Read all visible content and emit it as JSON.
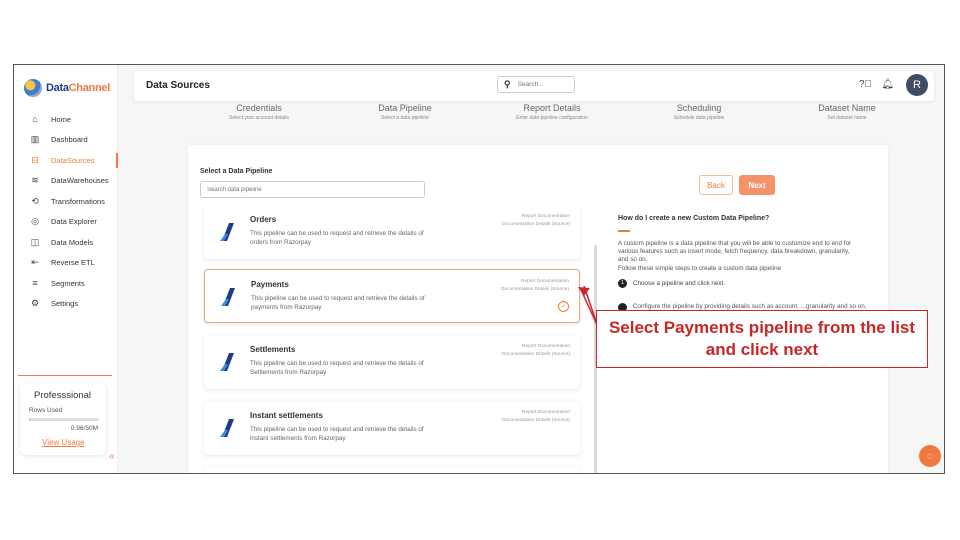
{
  "app": {
    "brand_prefix": "Data",
    "brand_suffix": "Channel"
  },
  "sidebar": {
    "items": [
      {
        "label": "Home",
        "icon": "home-icon",
        "glyph": "⌂"
      },
      {
        "label": "Dashboard",
        "icon": "dashboard-icon",
        "glyph": "▥"
      },
      {
        "label": "DataSources",
        "icon": "datasources-icon",
        "glyph": "⊟",
        "active": true
      },
      {
        "label": "DataWarehouses",
        "icon": "database-icon",
        "glyph": "≋"
      },
      {
        "label": "Transformations",
        "icon": "transform-icon",
        "glyph": "⟲"
      },
      {
        "label": "Data Explorer",
        "icon": "explorer-icon",
        "glyph": "◎"
      },
      {
        "label": "Data Models",
        "icon": "models-icon",
        "glyph": "◫"
      },
      {
        "label": "Reverse ETL",
        "icon": "reverse-etl-icon",
        "glyph": "⇤"
      },
      {
        "label": "Segments",
        "icon": "segments-icon",
        "glyph": "≡"
      },
      {
        "label": "Settings",
        "icon": "settings-icon",
        "glyph": "⚙"
      }
    ],
    "plan": {
      "title": "Professsional",
      "rows_label": "Rows Used",
      "rows_used_fraction": 0.02,
      "rows_count": "0.96/50M",
      "view_usage": "View Usage",
      "collapse_glyph": "«"
    }
  },
  "header": {
    "title": "Data Sources",
    "search_placeholder": "Search...",
    "avatar_letter": "R"
  },
  "steps": [
    {
      "title": "Credentials",
      "subtitle": "Select your account details"
    },
    {
      "title": "Data Pipeline",
      "subtitle": "Select a data pipeline"
    },
    {
      "title": "Report Details",
      "subtitle": "Enter data pipeline configuration"
    },
    {
      "title": "Scheduling",
      "subtitle": "Schedule data pipeline"
    },
    {
      "title": "Dataset Name",
      "subtitle": "Set dataset name"
    }
  ],
  "main": {
    "select_label": "Select a Data Pipeline",
    "pipeline_search_placeholder": "Search data pipeline",
    "back_label": "Back",
    "next_label": "Next",
    "doc_line1": "Report Documentation",
    "doc_line2": "Documentation Details (Source)",
    "pipelines": [
      {
        "name": "Orders",
        "description": "This pipeline can be used to request and retrieve the details of orders from Razorpay",
        "selected": false
      },
      {
        "name": "Payments",
        "description": "This pipeline can be used to request and retrieve the details of payments from Razorpay",
        "selected": true
      },
      {
        "name": "Settlements",
        "description": "This pipeline can be used to request and retrieve the details of Settlements from Razorpay",
        "selected": false
      },
      {
        "name": "Instant settlements",
        "description": "This pipeline can be used to request and retrieve the details of instant settlements from Razorpay",
        "selected": false
      }
    ]
  },
  "help": {
    "title": "How do I create a new Custom Data Pipeline?",
    "body": "A custom pipeline is a data pipeline that you will be able to customize end to end for various features such as insert mode, fetch frequency, data breakdown, granularity, and so on.",
    "intro": "Follow these simple steps to create a custom data pipeline",
    "step1_number": "1",
    "step1": "Choose a pipeline and click next.",
    "step2": "Configure the pipeline by providing details such as account, ...granularity and so on, then click next to schedule and"
  },
  "annotation": {
    "callout": "Select Payments pipeline from the list and click next",
    "color": "#c62828"
  },
  "colors": {
    "accent": "#f07a3e",
    "brand": "#1e3f8a",
    "avatar": "#3f4f63"
  }
}
